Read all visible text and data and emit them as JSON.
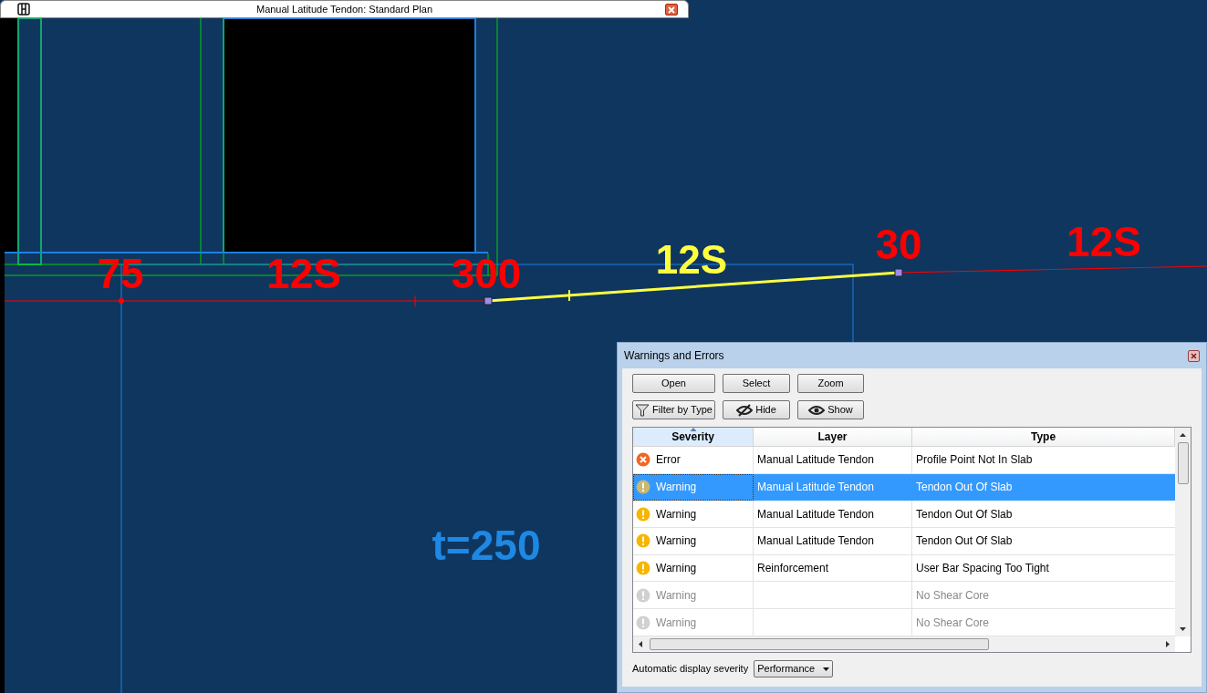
{
  "window": {
    "title": "Manual Latitude Tendon: Standard Plan"
  },
  "canvas": {
    "labels": [
      {
        "text": "75",
        "color": "#ff0000"
      },
      {
        "text": "12S",
        "color": "#ff0000"
      },
      {
        "text": "300",
        "color": "#ff0000"
      },
      {
        "text": "12S",
        "color": "#ffff40"
      },
      {
        "text": "30",
        "color": "#ff0000"
      },
      {
        "text": "12S",
        "color": "#ff0000"
      },
      {
        "text": "t=250",
        "color": "#1e88e5"
      }
    ]
  },
  "dialog": {
    "title": "Warnings and Errors",
    "buttons": [
      {
        "label": "Open",
        "kind": "plain"
      },
      {
        "label": "Select",
        "kind": "plain"
      },
      {
        "label": "Zoom",
        "kind": "plain"
      },
      {
        "label": "Filter by Type",
        "kind": "filter"
      },
      {
        "label": "Hide",
        "kind": "hide"
      },
      {
        "label": "Show",
        "kind": "show"
      }
    ],
    "table": {
      "columns": [
        {
          "label": "Severity",
          "sorted": true
        },
        {
          "label": "Layer",
          "sorted": false
        },
        {
          "label": "Type",
          "sorted": false
        }
      ],
      "rows": [
        {
          "severity": "Error",
          "kind": "error",
          "layer": "Manual Latitude Tendon",
          "type": "Profile Point Not In Slab",
          "selected": false,
          "disabled": false
        },
        {
          "severity": "Warning",
          "kind": "warning",
          "layer": "Manual Latitude Tendon",
          "type": "Tendon Out Of Slab",
          "selected": true,
          "disabled": false
        },
        {
          "severity": "Warning",
          "kind": "warning",
          "layer": "Manual Latitude Tendon",
          "type": "Tendon Out Of Slab",
          "selected": false,
          "disabled": false
        },
        {
          "severity": "Warning",
          "kind": "warning",
          "layer": "Manual Latitude Tendon",
          "type": "Tendon Out Of Slab",
          "selected": false,
          "disabled": false
        },
        {
          "severity": "Warning",
          "kind": "warning",
          "layer": "Reinforcement",
          "type": "User Bar Spacing Too Tight",
          "selected": false,
          "disabled": false
        },
        {
          "severity": "Warning",
          "kind": "warning",
          "type": "No Shear Core",
          "selected": false,
          "disabled": true
        },
        {
          "severity": "Warning",
          "kind": "warning",
          "type": "No Shear Core",
          "selected": false,
          "disabled": true
        }
      ]
    },
    "severity_label": "Automatic display severity",
    "severity_select": {
      "value": "Performance"
    }
  }
}
